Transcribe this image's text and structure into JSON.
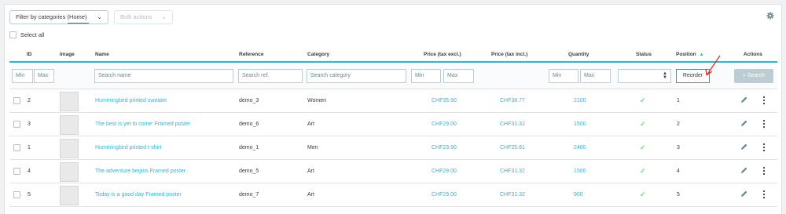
{
  "toolbar": {
    "filter_label": "Filter by categories (Home)",
    "bulk_label": "Bulk actions",
    "select_all_label": "Select all"
  },
  "columns": {
    "id": "ID",
    "image": "Image",
    "name": "Name",
    "reference": "Reference",
    "category": "Category",
    "price_excl": "Price (tax excl.)",
    "price_incl": "Price (tax incl.)",
    "quantity": "Quantity",
    "status": "Status",
    "position": "Position",
    "actions": "Actions"
  },
  "filters": {
    "id_min": "Min",
    "id_max": "Max",
    "name": "Search name",
    "ref": "Search ref.",
    "category": "Search category",
    "price_excl_min": "Min",
    "price_excl_max": "Max",
    "qty_min": "Min",
    "qty_max": "Max",
    "reorder": "Reorder",
    "search": "Search"
  },
  "rows": [
    {
      "id": "2",
      "name": "Hummingbird printed sweater",
      "ref": "demo_3",
      "category": "Women",
      "price_excl": "CHF35.90",
      "price_incl": "CHF38.77",
      "qty": "2100",
      "position": "1"
    },
    {
      "id": "3",
      "name": "The best is yet to come' Framed poster",
      "ref": "demo_6",
      "category": "Art",
      "price_excl": "CHF29.00",
      "price_incl": "CHF31.32",
      "qty": "1500",
      "position": "2"
    },
    {
      "id": "1",
      "name": "Hummingbird printed t-shirt",
      "ref": "demo_1",
      "category": "Men",
      "price_excl": "CHF23.90",
      "price_incl": "CHF25.81",
      "qty": "2400",
      "position": "3"
    },
    {
      "id": "4",
      "name": "The adventure begins Framed poster",
      "ref": "demo_5",
      "category": "Art",
      "price_excl": "CHF29.00",
      "price_incl": "CHF31.32",
      "qty": "1500",
      "position": "4"
    },
    {
      "id": "5",
      "name": "Today is a good day Framed poster",
      "ref": "demo_7",
      "category": "Art",
      "price_excl": "CHF29.00",
      "price_incl": "CHF31.32",
      "qty": "900",
      "position": "5"
    }
  ],
  "colors": {
    "accent": "#25b9d7",
    "status_ok": "#78d07d",
    "annotation": "#e0312b"
  }
}
